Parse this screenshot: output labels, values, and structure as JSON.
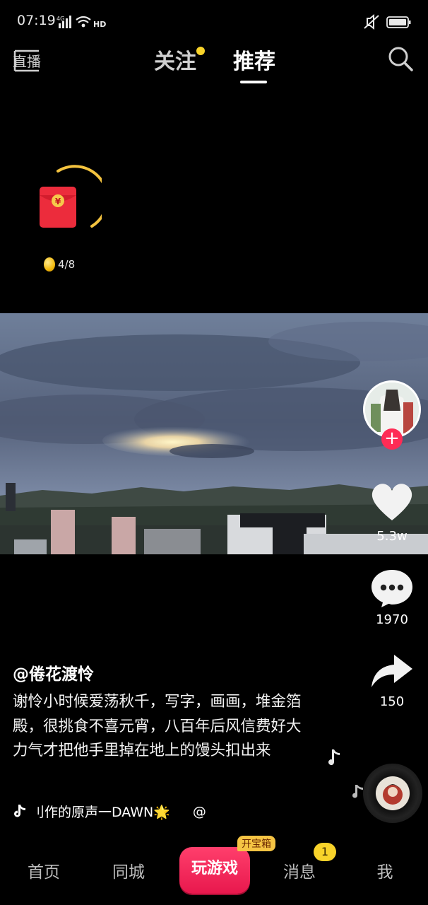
{
  "status_bar": {
    "time": "07:19",
    "network_label": "4G",
    "hd_label": "HD"
  },
  "nav": {
    "live_label": "直播",
    "follow_tab": "关注",
    "recommend_tab": "推荐",
    "active_tab": "推荐"
  },
  "reward": {
    "coin_progress": "4/8"
  },
  "rail": {
    "likes": "5.3w",
    "comments": "1970",
    "shares": "150"
  },
  "post": {
    "author": "@倦花渡怜",
    "caption": "谢怜小时候爱荡秋千，写字，画画，堆金箔殿，很挑食不喜元宵，八百年后风信费好大力气才把他手里掉在地上的馒头扣出来",
    "music": "刂作的原声一DAWN🌟",
    "music_suffix": "@"
  },
  "bottom_nav": {
    "home": "首页",
    "city": "同城",
    "game_button": "玩游戏",
    "treasure_tag": "开宝箱",
    "messages": "消息",
    "messages_badge": "1",
    "me": "我"
  },
  "colors": {
    "accent_red": "#fe2c55",
    "badge_yellow": "#f8d32a",
    "background": "#000000"
  }
}
